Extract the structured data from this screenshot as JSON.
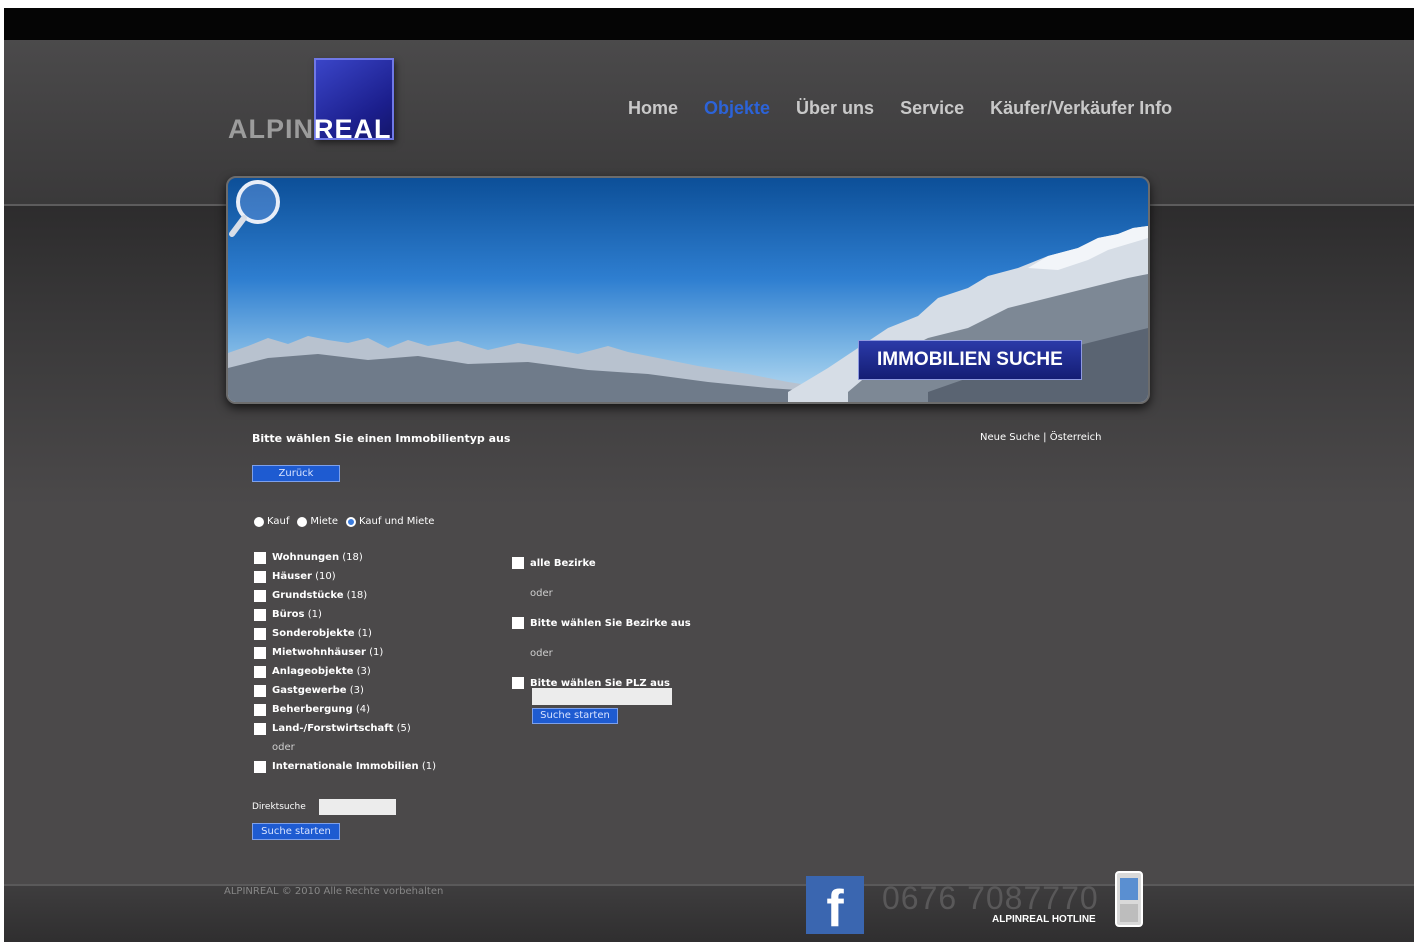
{
  "logo": {
    "part_light": "ALPIN",
    "part_bold": "REAL"
  },
  "nav": [
    {
      "label": "Home",
      "active": false
    },
    {
      "label": "Objekte",
      "active": true
    },
    {
      "label": "Über uns",
      "active": false
    },
    {
      "label": "Service",
      "active": false
    },
    {
      "label": "Käufer/Verkäufer Info",
      "active": false
    }
  ],
  "banner": {
    "tag": "IMMOBILIEN SUCHE"
  },
  "search": {
    "heading": "Bitte wählen Sie einen Immobilientyp aus",
    "links": {
      "new_search": "Neue Suche",
      "separator": "|",
      "country": "Österreich"
    },
    "back_button": "Zurück",
    "modes": [
      {
        "label": "Kauf",
        "selected": false
      },
      {
        "label": "Miete",
        "selected": false
      },
      {
        "label": "Kauf und Miete",
        "selected": true
      }
    ],
    "types": [
      {
        "label": "Wohnungen",
        "count": "(18)"
      },
      {
        "label": "Häuser",
        "count": "(10)"
      },
      {
        "label": "Grundstücke",
        "count": "(18)"
      },
      {
        "label": "Büros",
        "count": "(1)"
      },
      {
        "label": "Sonderobjekte",
        "count": "(1)"
      },
      {
        "label": "Mietwohnhäuser",
        "count": "(1)"
      },
      {
        "label": "Anlageobjekte",
        "count": "(3)"
      },
      {
        "label": "Gastgewerbe",
        "count": "(3)"
      },
      {
        "label": "Beherbergung",
        "count": "(4)"
      },
      {
        "label": "Land-/Forstwirtschaft",
        "count": "(5)"
      }
    ],
    "types_or": "oder",
    "international": {
      "label": "Internationale Immobilien",
      "count": "(1)"
    },
    "region": {
      "all_districts": "alle Bezirke",
      "or_1": "oder",
      "choose_districts": "Bitte wählen Sie Bezirke aus",
      "or_2": "oder",
      "choose_plz": "Bitte wählen Sie PLZ aus",
      "plz_value": "",
      "search_button": "Suche starten"
    },
    "direct": {
      "label": "Direktsuche",
      "value": "",
      "search_button": "Suche starten"
    }
  },
  "footer": {
    "copyright": "ALPINREAL © 2010 Alle Rechte vorbehalten",
    "facebook_glyph": "f",
    "phone": "0676 7087770",
    "hotline": "ALPINREAL HOTLINE"
  },
  "colors": {
    "accent": "#1e5bd1",
    "nav_active": "#2c63d8",
    "background": "#4a4849"
  }
}
